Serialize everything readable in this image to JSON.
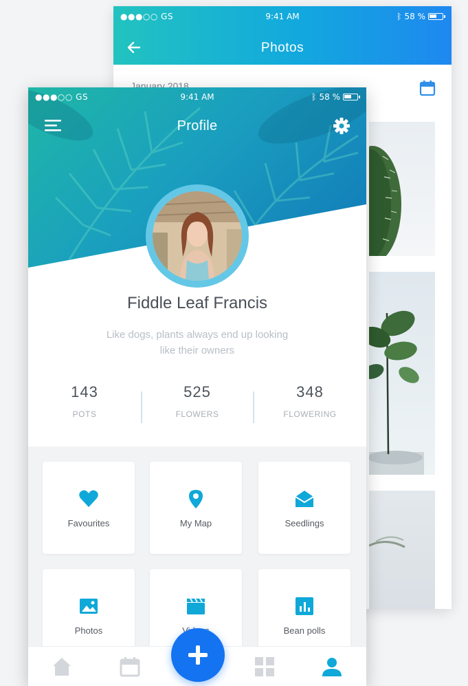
{
  "photos_screen": {
    "status": {
      "carrier": "●●●○○ GS",
      "time": "9:41 AM",
      "battery": "58 %"
    },
    "title": "Photos",
    "date_label": "January 2018",
    "icons": {
      "back": "arrow-left-icon",
      "calendar": "calendar-icon"
    }
  },
  "profile_screen": {
    "status": {
      "carrier": "●●●○○ GS",
      "time": "9:41 AM",
      "battery": "58 %"
    },
    "title": "Profile",
    "icons": {
      "menu": "hamburger-menu-icon",
      "settings": "gear-icon"
    },
    "user": {
      "name": "Fiddle Leaf Francis",
      "bio_line1": "Like dogs, plants always end up looking",
      "bio_line2": "like their owners"
    },
    "stats": [
      {
        "value": "143",
        "label": "POTS"
      },
      {
        "value": "525",
        "label": "FLOWERS"
      },
      {
        "value": "348",
        "label": "FLOWERING"
      }
    ],
    "tiles": [
      {
        "label": "Favourites",
        "icon": "heart-icon"
      },
      {
        "label": "My Map",
        "icon": "map-pin-icon"
      },
      {
        "label": "Seedlings",
        "icon": "open-mail-icon"
      },
      {
        "label": "Photos",
        "icon": "image-icon"
      },
      {
        "label": "Videos",
        "icon": "clapperboard-icon"
      },
      {
        "label": "Bean polls",
        "icon": "bar-chart-icon"
      }
    ],
    "tabbar": [
      "home-icon",
      "calendar-icon",
      "add-icon",
      "grid-icon",
      "user-icon"
    ]
  },
  "colors": {
    "accent_blue": "#1473f0",
    "icon_cyan": "#0fa8d8",
    "header_teal": "#1fb7a6",
    "header_blue": "#1e88f0",
    "tab_inactive": "#d3d6da"
  }
}
